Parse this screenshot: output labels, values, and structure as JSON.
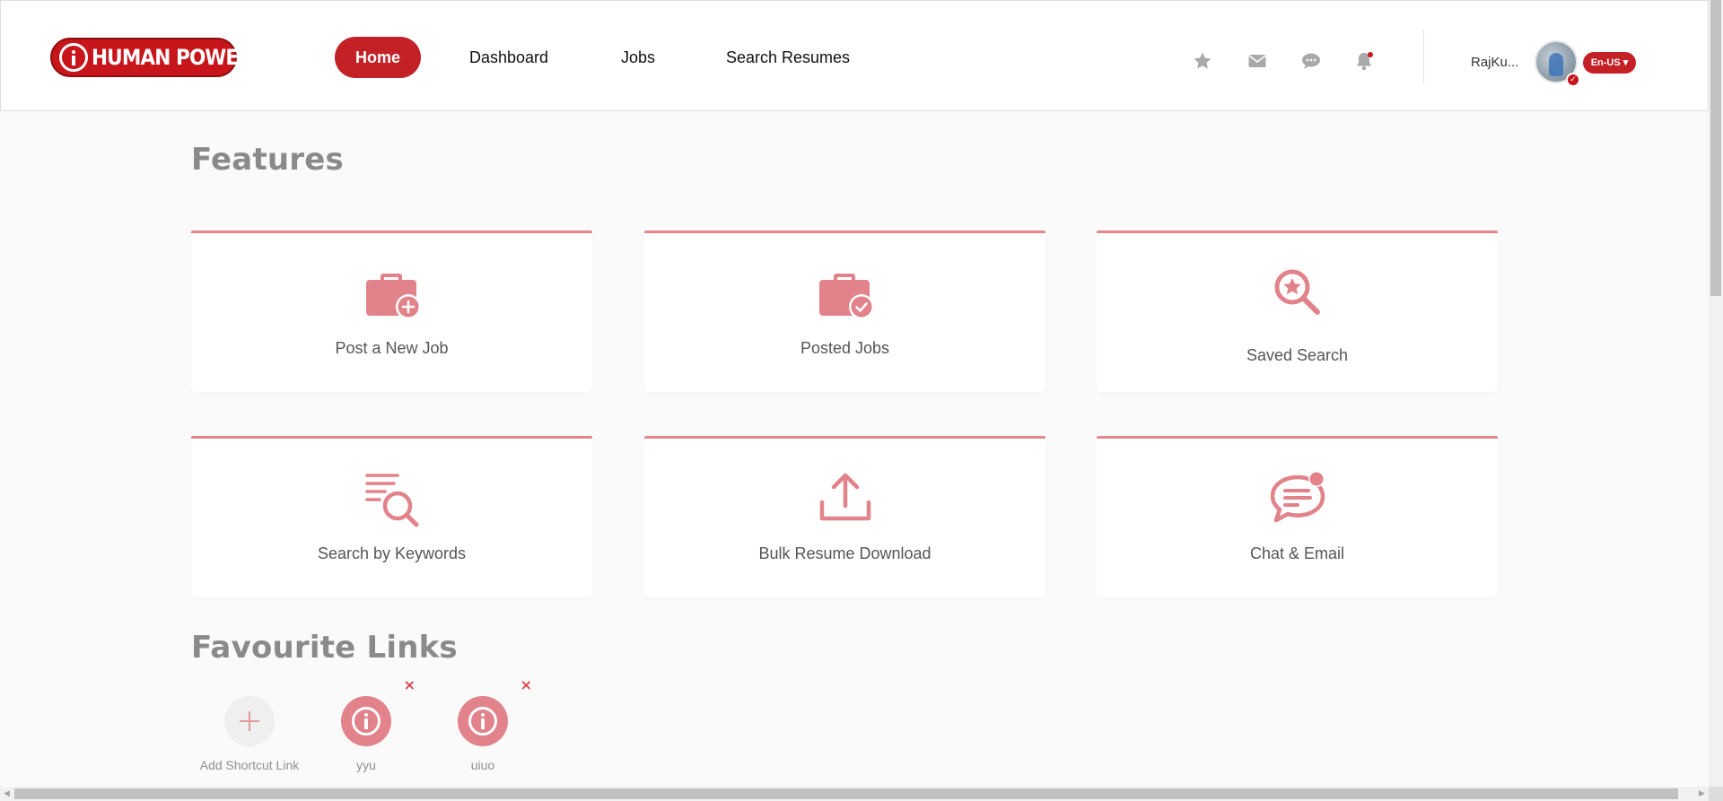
{
  "brand": {
    "logo_text": "HUMAN POWER"
  },
  "nav": {
    "home": "Home",
    "dashboard": "Dashboard",
    "jobs": "Jobs",
    "search_resumes": "Search Resumes"
  },
  "header_icons": [
    "star-icon",
    "mail-icon",
    "chat-icon",
    "bell-icon"
  ],
  "user": {
    "name": "RajKu...",
    "language": "En-US"
  },
  "features": {
    "title": "Features",
    "cards": [
      {
        "label": "Post a New Job",
        "icon": "briefcase-plus-icon"
      },
      {
        "label": "Posted Jobs",
        "icon": "briefcase-check-icon"
      },
      {
        "label": "Saved Search",
        "icon": "saved-search-icon"
      },
      {
        "label": "Search by Keywords",
        "icon": "keyword-search-icon"
      },
      {
        "label": "Bulk Resume Download",
        "icon": "upload-icon"
      },
      {
        "label": "Chat & Email",
        "icon": "chat-bubble-icon"
      }
    ]
  },
  "favourites": {
    "title": "Favourite Links",
    "add_label": "Add Shortcut Link",
    "links": [
      {
        "label": "yyu",
        "remove": "×"
      },
      {
        "label": "uiuo",
        "remove": "×"
      }
    ]
  },
  "colors": {
    "brand_red": "#c8141b",
    "accent_pink": "#e5858c",
    "card_bg": "#ffffff",
    "page_bg": "#fafafa"
  }
}
